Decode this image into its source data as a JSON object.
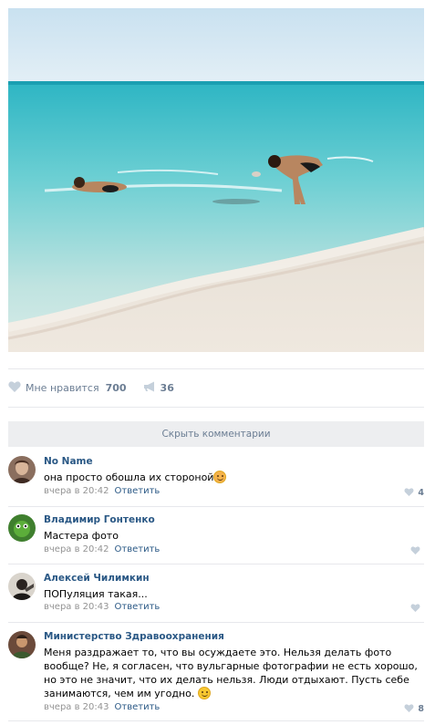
{
  "post": {
    "image_alt": "beach photo",
    "like_label": "Мне нравится",
    "like_count": "700",
    "share_count": "36"
  },
  "hide_comments_label": "Скрыть комментарии",
  "comments": [
    {
      "author": "No Name",
      "text": "она просто обошла их стороной",
      "emoji": "smile",
      "time": "вчера в 20:42",
      "reply": "Ответить",
      "likes": "4"
    },
    {
      "author": "Владимир Гонтенко",
      "text": "Мастера фото",
      "time": "вчера в 20:42",
      "reply": "Ответить",
      "likes": ""
    },
    {
      "author": "Алексей Чилимкин",
      "text": "ПОПуляция такая...",
      "time": "вчера в 20:43",
      "reply": "Ответить",
      "likes": ""
    },
    {
      "author": "Министерство Здравоохранения",
      "text": "Меня раздражает то, что вы осуждаете это. Нельзя делать фото вообще? Не, я согласен, что вульгарные фотографии не есть хорошо, но это не значит, что их делать нельзя. Люди отдыхают. Пусть себе занимаются, чем им угодно.",
      "emoji": "smile",
      "time": "вчера в 20:43",
      "reply": "Ответить",
      "likes": "8"
    }
  ],
  "colors": {
    "link": "#2a5885",
    "meta": "#939393",
    "accent": "#6b7d93",
    "button_bg": "#edeef0"
  }
}
